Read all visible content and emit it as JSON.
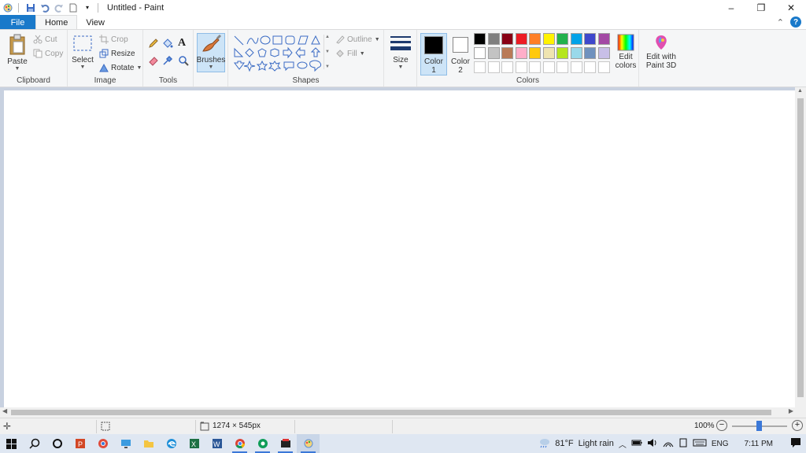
{
  "window": {
    "title": "Untitled - Paint",
    "minimize": "–",
    "restore": "❐",
    "close": "✕"
  },
  "tabs": {
    "file": "File",
    "home": "Home",
    "view": "View",
    "collapse": "⌃",
    "help": "?"
  },
  "ribbon": {
    "clipboard": {
      "label": "Clipboard",
      "paste": "Paste",
      "cut": "Cut",
      "copy": "Copy"
    },
    "image": {
      "label": "Image",
      "select": "Select",
      "crop": "Crop",
      "resize": "Resize",
      "rotate": "Rotate"
    },
    "tools": {
      "label": "Tools"
    },
    "brushes": {
      "label": "Brushes"
    },
    "shapes": {
      "label": "Shapes",
      "outline": "Outline",
      "fill": "Fill"
    },
    "size": {
      "label": "Size"
    },
    "colors": {
      "label": "Colors",
      "color1_a": "Color",
      "color1_b": "1",
      "color2_a": "Color",
      "color2_b": "2",
      "edit_a": "Edit",
      "edit_b": "colors",
      "paint3d_a": "Edit with",
      "paint3d_b": "Paint 3D",
      "row1": [
        "#000000",
        "#7f7f7f",
        "#880015",
        "#ed1c24",
        "#ff7f27",
        "#fff200",
        "#22b14c",
        "#00a2e8",
        "#3f48cc",
        "#a349a4"
      ],
      "row2": [
        "#ffffff",
        "#c3c3c3",
        "#b97a57",
        "#ffaec9",
        "#ffc90e",
        "#efe4b0",
        "#b5e61d",
        "#99d9ea",
        "#7092be",
        "#c8bfe7"
      ]
    }
  },
  "status": {
    "dimensions": "1274 × 545px",
    "zoom": "100%"
  },
  "taskbar": {
    "weather_temp": "81°F",
    "weather_text": "Light rain",
    "lang": "ENG",
    "time": "7:11 PM"
  }
}
